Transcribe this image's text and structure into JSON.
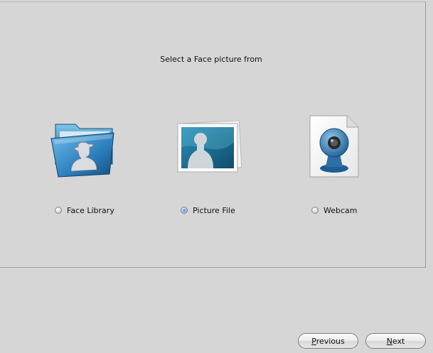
{
  "wizard": {
    "heading": "Select a Face picture from",
    "options": [
      {
        "label": "Face Library",
        "icon": "folder-silhouette-icon",
        "selected": false
      },
      {
        "label": "Picture File",
        "icon": "photo-silhouette-icon",
        "selected": true
      },
      {
        "label": "Webcam",
        "icon": "webcam-icon",
        "selected": false
      }
    ]
  },
  "buttons": {
    "previous": {
      "mnemonic": "P",
      "rest": "revious"
    },
    "next": {
      "mnemonic": "N",
      "rest": "ext"
    }
  },
  "colors": {
    "background": "#d6d6d6",
    "accent_blue": "#2f6fb0",
    "radio_selected": "#3a62c4"
  }
}
